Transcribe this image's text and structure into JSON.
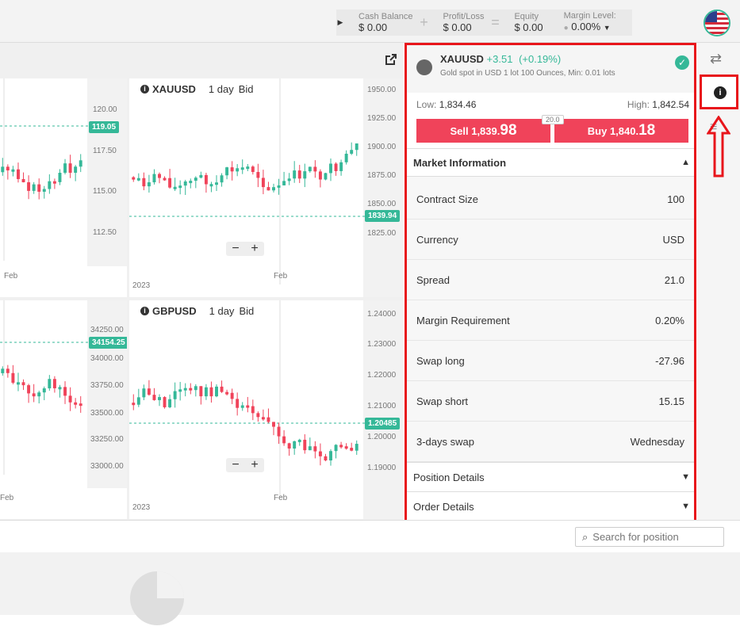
{
  "account": {
    "cash_balance_label": "Cash Balance",
    "cash_balance": "$ 0.00",
    "pl_label": "Profit/Loss",
    "pl": "$ 0.00",
    "equity_label": "Equity",
    "equity": "$ 0.00",
    "margin_label": "Margin Level:",
    "margin": "0.00%"
  },
  "charts": [
    {
      "symbol": "XAUUSD",
      "period": "1 day",
      "side": "Bid",
      "ticks": [
        "1950.00",
        "1925.00",
        "1900.00",
        "1875.00",
        "1850.00",
        "1825.00"
      ],
      "price": "1839.94",
      "x_labels": [
        "2023",
        "Feb"
      ]
    },
    {
      "symbol": "GBPUSD",
      "period": "1 day",
      "side": "Bid",
      "ticks": [
        "1.24000",
        "1.23000",
        "1.22000",
        "1.21000",
        "1.20000",
        "1.19000"
      ],
      "price": "1.20485",
      "x_labels": [
        "2023",
        "Feb"
      ]
    },
    {
      "ticks": [
        "120.00",
        "117.50",
        "115.00",
        "112.50"
      ],
      "price": "119.05",
      "x_labels": [
        "Feb"
      ]
    },
    {
      "ticks": [
        "34250.00",
        "34000.00",
        "33750.00",
        "33500.00",
        "33250.00",
        "33000.00"
      ],
      "price": "34154.25",
      "x_labels": [
        "Feb"
      ]
    }
  ],
  "zoom": {
    "minus": "−",
    "plus": "+"
  },
  "instrument": {
    "symbol": "XAUUSD",
    "change": "+3.51",
    "change_pct": "(+0.19%)",
    "description": "Gold spot in USD 1 lot 100 Ounces, Min: 0.01 lots",
    "low_label": "Low:",
    "low": "1,834.46",
    "high_label": "High:",
    "high": "1,842.54",
    "sell_label": "Sell",
    "sell_main": "1,839.",
    "sell_big": "98",
    "buy_label": "Buy",
    "buy_main": "1,840.",
    "buy_big": "18",
    "spread_badge": "20.0"
  },
  "market_info": {
    "title": "Market Information",
    "rows": [
      {
        "label": "Contract Size",
        "value": "100"
      },
      {
        "label": "Currency",
        "value": "USD"
      },
      {
        "label": "Spread",
        "value": "21.0"
      },
      {
        "label": "Margin Requirement",
        "value": "0.20%"
      },
      {
        "label": "Swap long",
        "value": "-27.96"
      },
      {
        "label": "Swap short",
        "value": "15.15"
      },
      {
        "label": "3-days swap",
        "value": "Wednesday"
      }
    ]
  },
  "sections": {
    "position": "Position Details",
    "order": "Order Details"
  },
  "search": {
    "placeholder": "Search for position"
  },
  "colors": {
    "accent": "#35b898",
    "sell": "#f0435a",
    "buy": "#f0435a",
    "highlight": "#e8151b"
  }
}
